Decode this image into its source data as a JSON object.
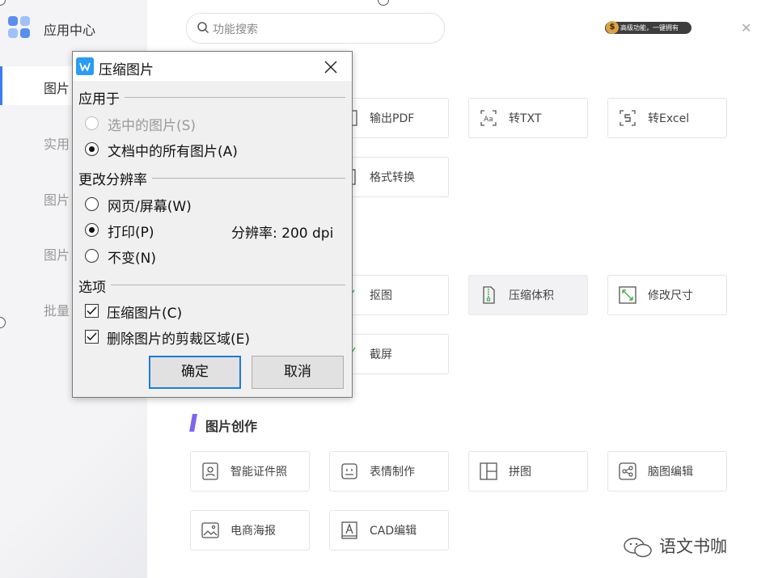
{
  "sidebar": {
    "title": "应用中心",
    "items": [
      {
        "label": "图片",
        "active": true
      },
      {
        "label": "实用",
        "active": false
      },
      {
        "label": "图片",
        "active": false
      },
      {
        "label": "图片",
        "active": false
      },
      {
        "label": "批量",
        "active": false
      }
    ]
  },
  "search": {
    "placeholder": "功能搜索"
  },
  "premium": {
    "text": "高级功能，一键拥有",
    "coin": "$"
  },
  "colors": {
    "accent": "#3b7cf5",
    "brand_blue": "#2b9cf2",
    "section_bar": "#7b68ee",
    "icon_green": "#4caf50"
  },
  "tools_row1": [
    {
      "label": "输出PDF",
      "icon": "pdf-export-icon"
    },
    {
      "label": "转TXT",
      "icon": "text-convert-icon"
    },
    {
      "label": "转Excel",
      "icon": "excel-convert-icon"
    }
  ],
  "tools_row2": [
    {
      "label": "格式转换",
      "icon": "format-convert-icon"
    }
  ],
  "tools_row3": [
    {
      "label": "抠图",
      "icon": "cutout-icon"
    },
    {
      "label": "压缩体积",
      "icon": "compress-file-icon"
    },
    {
      "label": "修改尺寸",
      "icon": "resize-icon"
    }
  ],
  "tools_row4": [
    {
      "label": "截屏",
      "icon": "scissors-icon"
    }
  ],
  "creation": {
    "title": "图片创作",
    "items": [
      {
        "label": "智能证件照",
        "icon": "id-photo-icon"
      },
      {
        "label": "表情制作",
        "icon": "emoji-icon"
      },
      {
        "label": "拼图",
        "icon": "collage-icon"
      },
      {
        "label": "脑图编辑",
        "icon": "mindmap-icon"
      },
      {
        "label": "电商海报",
        "icon": "poster-icon"
      },
      {
        "label": "CAD编辑",
        "icon": "cad-icon"
      }
    ]
  },
  "dialog": {
    "title": "压缩图片",
    "apply_to": {
      "label": "应用于",
      "options": [
        {
          "label": "选中的图片(S)",
          "disabled": true,
          "selected": false
        },
        {
          "label": "文档中的所有图片(A)",
          "disabled": false,
          "selected": true
        }
      ]
    },
    "resolution": {
      "label": "更改分辨率",
      "options": [
        {
          "label": "网页/屏幕(W)",
          "selected": false
        },
        {
          "label": "打印(P)",
          "selected": true
        },
        {
          "label": "不变(N)",
          "selected": false
        }
      ],
      "dpi_label": "分辨率:",
      "dpi_value": "200 dpi"
    },
    "options": {
      "label": "选项",
      "items": [
        {
          "label": "压缩图片(C)",
          "checked": true
        },
        {
          "label": "删除图片的剪裁区域(E)",
          "checked": true
        }
      ]
    },
    "ok": "确定",
    "cancel": "取消"
  },
  "watermark": {
    "text": "语文书咖"
  }
}
